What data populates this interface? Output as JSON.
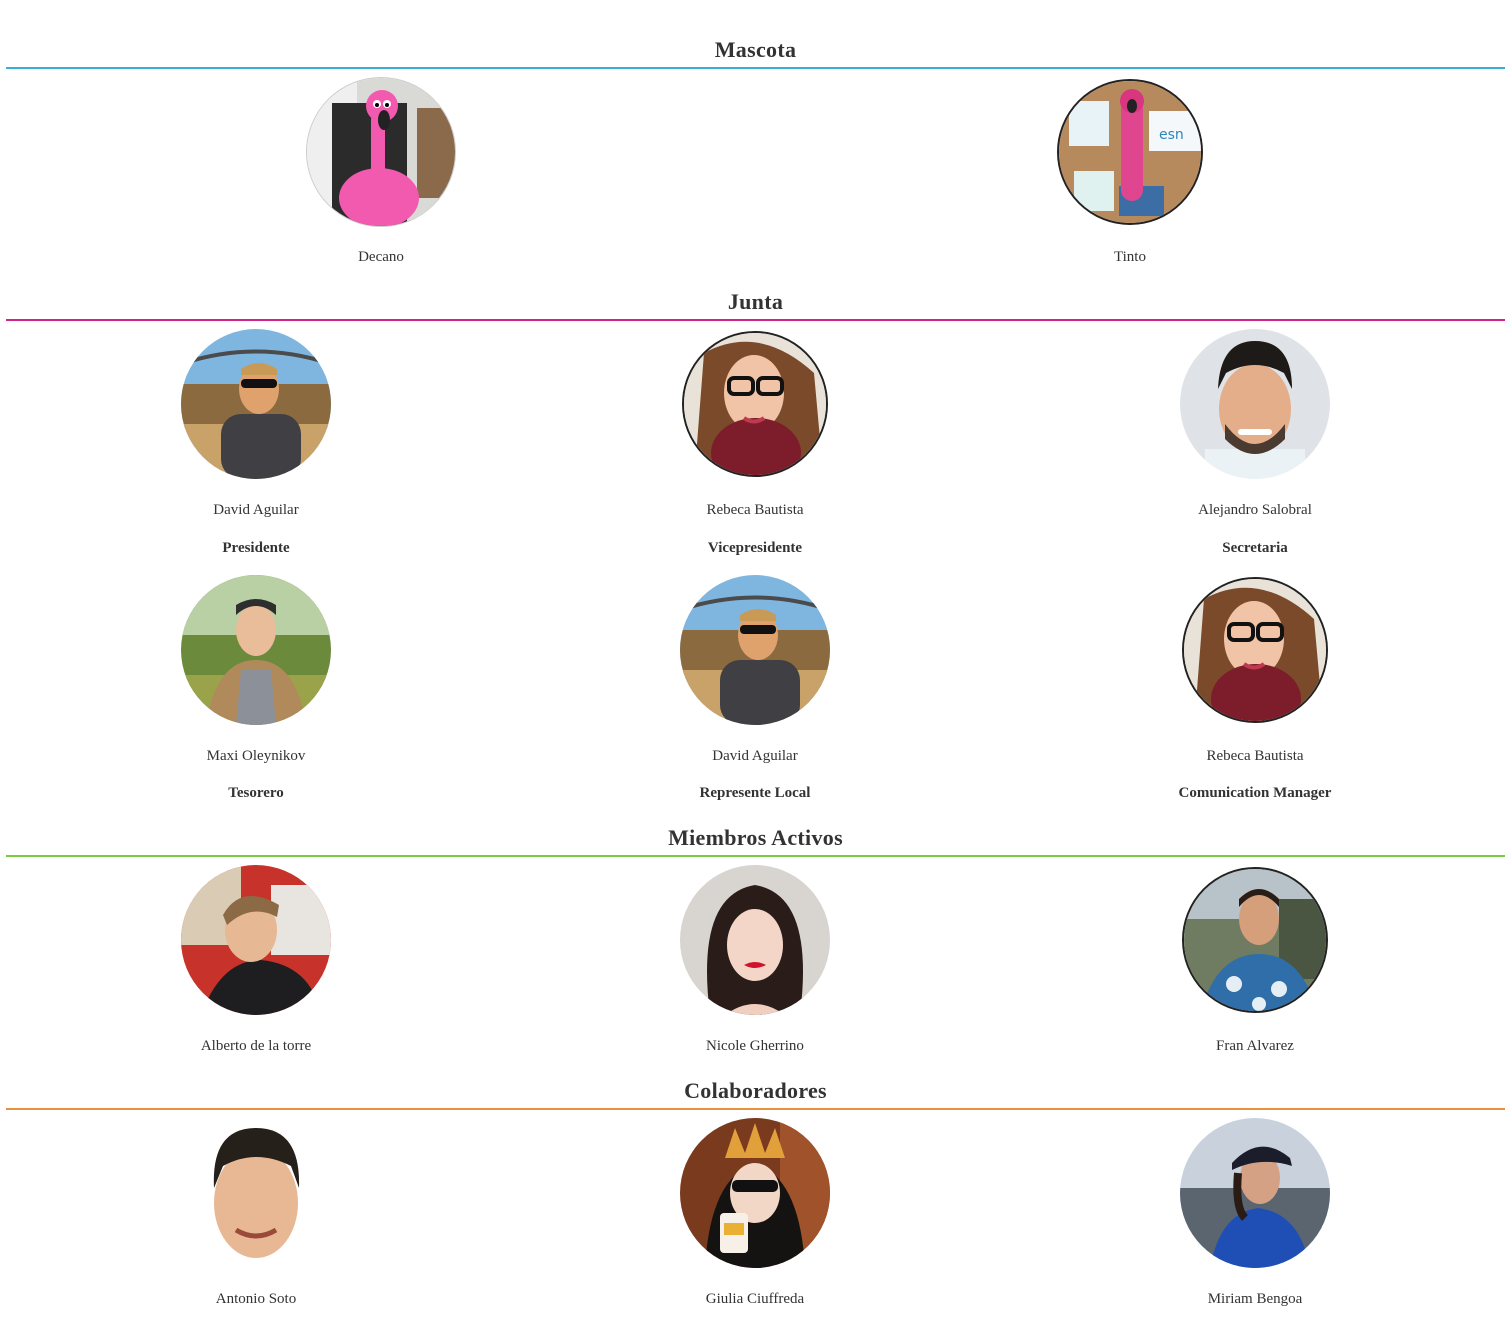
{
  "colors": {
    "mascota_line": "#39aed3",
    "junta_line": "#d1258b",
    "activos_line": "#7ac943",
    "colab_line": "#e8913d"
  },
  "sections": {
    "mascota": {
      "title": "Mascota",
      "members": [
        {
          "name": "Decano"
        },
        {
          "name": "Tinto"
        }
      ]
    },
    "junta": {
      "title": "Junta",
      "members": [
        {
          "name": "David Aguilar",
          "role": "Presidente"
        },
        {
          "name": "Rebeca Bautista",
          "role": "Vicepresidente"
        },
        {
          "name": "Alejandro Salobral",
          "role": "Secretaria"
        },
        {
          "name": "Maxi Oleynikov",
          "role": "Tesorero"
        },
        {
          "name": "David Aguilar",
          "role": "Represente Local"
        },
        {
          "name": "Rebeca Bautista",
          "role": "Comunication Manager"
        }
      ]
    },
    "activos": {
      "title": "Miembros Activos",
      "members": [
        {
          "name": "Alberto de la torre"
        },
        {
          "name": "Nicole Gherrino"
        },
        {
          "name": "Fran Alvarez"
        }
      ]
    },
    "colaboradores": {
      "title": "Colaboradores",
      "members": [
        {
          "name": "Antonio Soto"
        },
        {
          "name": "Giulia Ciuffreda"
        },
        {
          "name": "Miriam Bengoa"
        }
      ]
    }
  }
}
